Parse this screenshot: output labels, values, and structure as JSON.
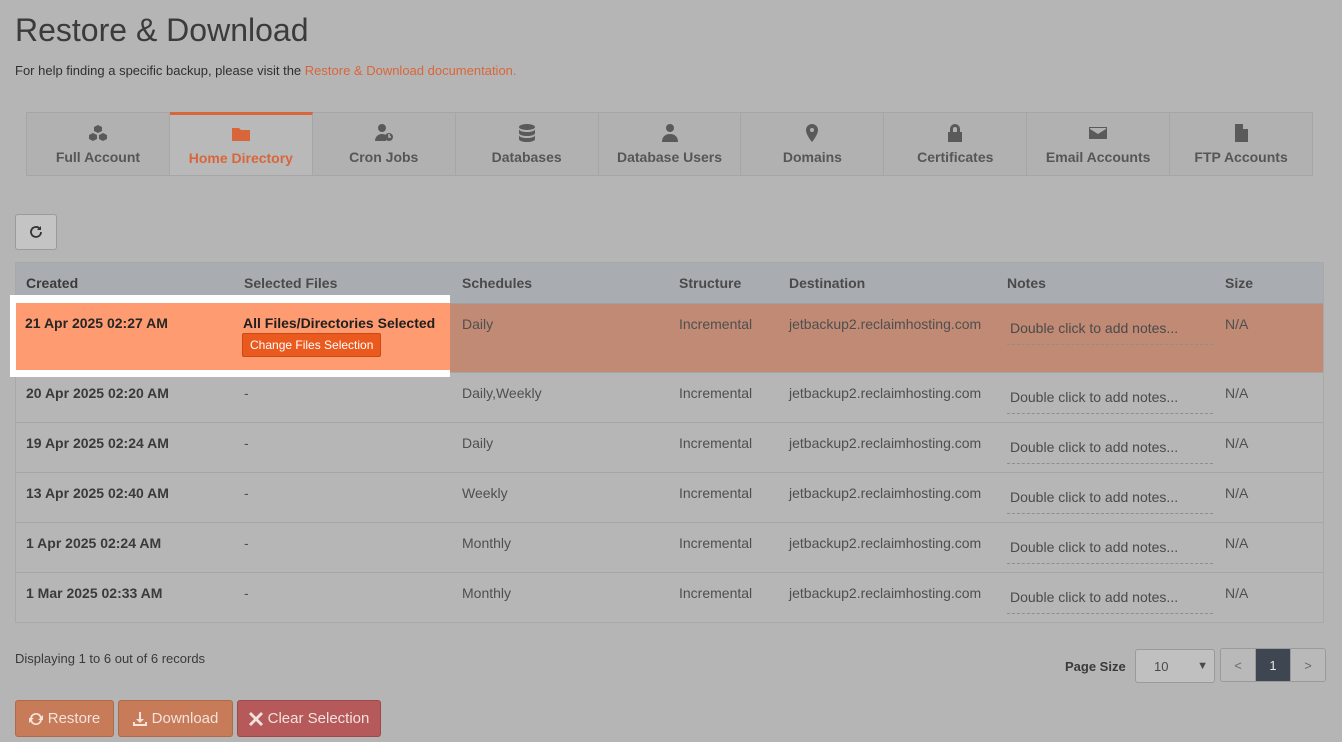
{
  "header": {
    "title": "Restore & Download",
    "help_prefix": "For help finding a specific backup, please visit the ",
    "help_link": "Restore & Download documentation."
  },
  "tabs": [
    {
      "label": "Full Account",
      "icon": "cubes-icon"
    },
    {
      "label": "Home Directory",
      "icon": "folder-icon",
      "active": true
    },
    {
      "label": "Cron Jobs",
      "icon": "user-clock-icon"
    },
    {
      "label": "Databases",
      "icon": "database-icon"
    },
    {
      "label": "Database Users",
      "icon": "user-tie-icon"
    },
    {
      "label": "Domains",
      "icon": "map-marker-icon"
    },
    {
      "label": "Certificates",
      "icon": "lock-icon"
    },
    {
      "label": "Email Accounts",
      "icon": "envelope-icon"
    },
    {
      "label": "FTP Accounts",
      "icon": "file-icon"
    }
  ],
  "table": {
    "headers": [
      "Created",
      "Selected Files",
      "Schedules",
      "Structure",
      "Destination",
      "Notes",
      "Size"
    ],
    "rows": [
      {
        "created": "21 Apr 2025 02:27 AM",
        "files": "All Files/Directories Selected",
        "schedules": "Daily",
        "structure": "Incremental",
        "destination": "jetbackup2.reclaimhosting.com",
        "notes": "Double click to add notes...",
        "size": "N/A"
      },
      {
        "created": "20 Apr 2025 02:20 AM",
        "files": "-",
        "schedules": "Daily,Weekly",
        "structure": "Incremental",
        "destination": "jetbackup2.reclaimhosting.com",
        "notes": "Double click to add notes...",
        "size": "N/A"
      },
      {
        "created": "19 Apr 2025 02:24 AM",
        "files": "-",
        "schedules": "Daily",
        "structure": "Incremental",
        "destination": "jetbackup2.reclaimhosting.com",
        "notes": "Double click to add notes...",
        "size": "N/A"
      },
      {
        "created": "13 Apr 2025 02:40 AM",
        "files": "-",
        "schedules": "Weekly",
        "structure": "Incremental",
        "destination": "jetbackup2.reclaimhosting.com",
        "notes": "Double click to add notes...",
        "size": "N/A"
      },
      {
        "created": "1 Apr 2025 02:24 AM",
        "files": "-",
        "schedules": "Monthly",
        "structure": "Incremental",
        "destination": "jetbackup2.reclaimhosting.com",
        "notes": "Double click to add notes...",
        "size": "N/A"
      },
      {
        "created": "1 Mar 2025 02:33 AM",
        "files": "-",
        "schedules": "Monthly",
        "structure": "Incremental",
        "destination": "jetbackup2.reclaimhosting.com",
        "notes": "Double click to add notes...",
        "size": "N/A"
      }
    ],
    "change_files_label": "Change Files Selection"
  },
  "footer": {
    "display_info": "Displaying 1 to 6 out of 6 records",
    "page_size_label": "Page Size",
    "page_size_value": "10",
    "prev": "<",
    "current_page": "1",
    "next": ">"
  },
  "actions": {
    "restore": "Restore",
    "download": "Download",
    "clear": "Clear Selection"
  },
  "colors": {
    "accent": "#d9663a",
    "selected_row": "#ff9b70",
    "button_orange": "#ea5a1e"
  }
}
